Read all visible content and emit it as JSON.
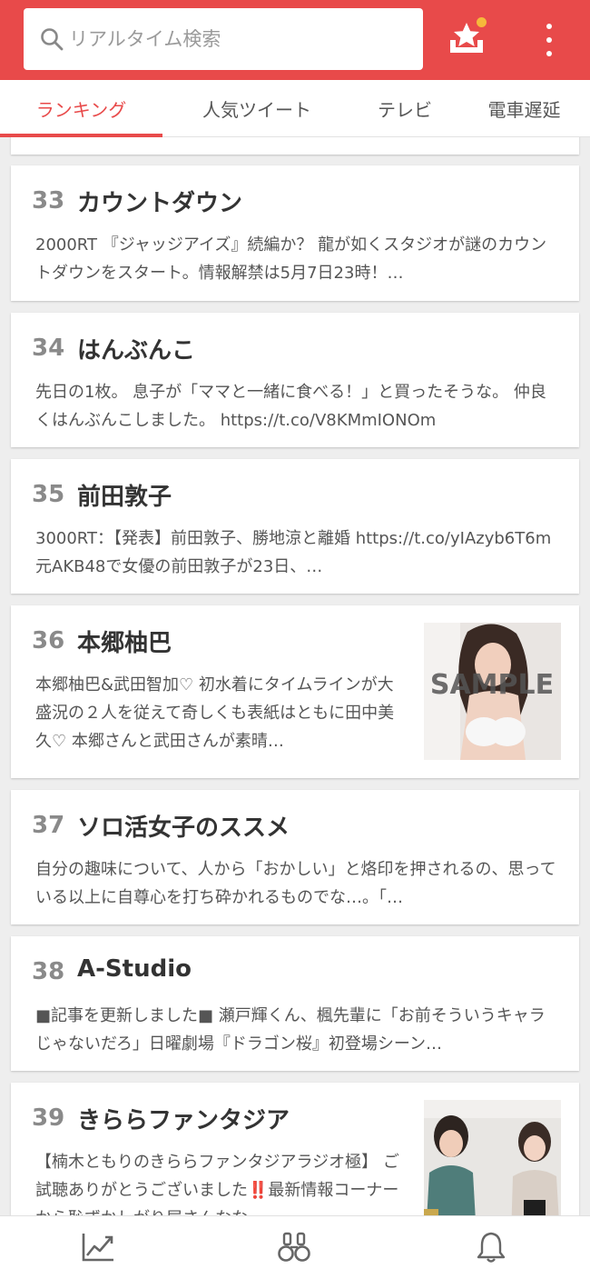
{
  "search": {
    "placeholder": "リアルタイム検索"
  },
  "header": {
    "icons": [
      "search-icon",
      "favorite-star-icon",
      "more-vert-icon"
    ],
    "accent": "#e84a4a",
    "badge_color": "#f6b93b"
  },
  "tabs": [
    {
      "label": "ランキング",
      "active": true
    },
    {
      "label": "人気ツイート",
      "active": false
    },
    {
      "label": "テレビ",
      "active": false
    },
    {
      "label": "電車遅延",
      "active": false
    }
  ],
  "items": [
    {
      "rank": "33",
      "title": "カウントダウン",
      "summary": "2000RT 『ジャッジアイズ』続編か？ 龍が如くスタジオが謎のカウントダウンをスタート。情報解禁は5月7日23時！…"
    },
    {
      "rank": "34",
      "title": "はんぶんこ",
      "summary": "先日の1枚。 息子が「ママと一緒に食べる！」と買ったそうな。 仲良くはんぶんこしました。 https://t.co/V8KMmIONOm"
    },
    {
      "rank": "35",
      "title": "前田敦子",
      "summary": "3000RT：【発表】前田敦子、勝地涼と離婚 https://t.co/yIAzyb6T6m 元AKB48で女優の前田敦子が23日、…"
    },
    {
      "rank": "36",
      "title": "本郷柚巴",
      "summary": "本郷柚巴&武田智加♡ 初水着にタイムラインが大盛況の２人を従えて奇しくも表紙はともに田中美久♡ 本郷さんと武田さんが素晴…",
      "thumb_text": "SAMPLE"
    },
    {
      "rank": "37",
      "title": "ソロ活女子のススメ",
      "summary": "自分の趣味について、人から「おかしい」と烙印を押されるの、思っている以上に自尊心を打ち砕かれるものでな…。「…"
    },
    {
      "rank": "38",
      "title": "A-Studio",
      "summary": "■記事を更新しました■ 瀬戸輝くん、楓先輩に「お前そういうキャラじゃないだろ」日曜劇場『ドラゴン桜』初登場シーン…"
    },
    {
      "rank": "39",
      "title": "きららファンタジア",
      "summary": "【楠木ともりのきららファンタジアラジオ極】 ご試聴ありがとうございました‼️最新情報コーナーから恥ずかしがり屋さんなな…"
    }
  ],
  "bottom_nav": [
    {
      "icon": "trend-chart-icon"
    },
    {
      "icon": "binoculars-icon"
    },
    {
      "icon": "bell-icon"
    }
  ]
}
